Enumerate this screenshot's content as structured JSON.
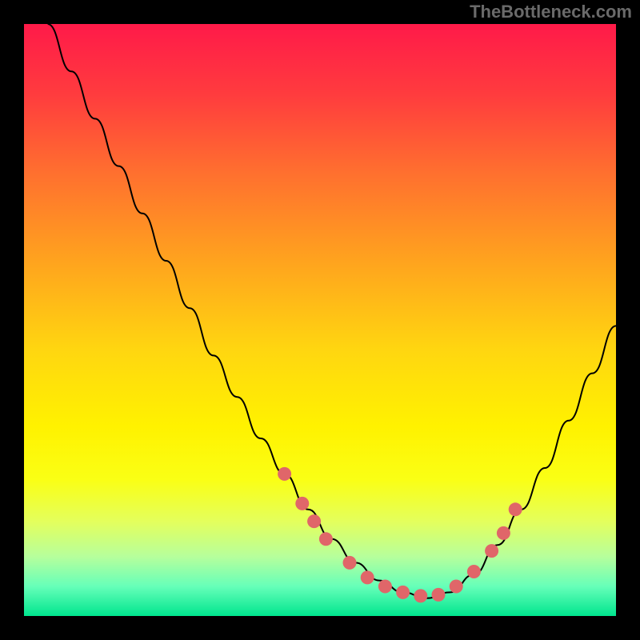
{
  "attribution": "TheBottleneck.com",
  "chart_data": {
    "type": "line",
    "title": "",
    "xlabel": "",
    "ylabel": "",
    "xlim": [
      0,
      100
    ],
    "ylim": [
      0,
      100
    ],
    "gradient_stops": [
      {
        "offset": 0,
        "color": "#ff1a49"
      },
      {
        "offset": 12,
        "color": "#ff3c3e"
      },
      {
        "offset": 25,
        "color": "#ff6f2f"
      },
      {
        "offset": 40,
        "color": "#ffa31e"
      },
      {
        "offset": 55,
        "color": "#ffd610"
      },
      {
        "offset": 68,
        "color": "#fff200"
      },
      {
        "offset": 77,
        "color": "#faff15"
      },
      {
        "offset": 84,
        "color": "#e4ff5c"
      },
      {
        "offset": 90,
        "color": "#b6ff9c"
      },
      {
        "offset": 95,
        "color": "#66ffb9"
      },
      {
        "offset": 100,
        "color": "#00e58e"
      }
    ],
    "series": [
      {
        "name": "bottleneck-curve",
        "x": [
          4,
          8,
          12,
          16,
          20,
          24,
          28,
          32,
          36,
          40,
          44,
          48,
          52,
          56,
          60,
          64,
          68,
          72,
          76,
          80,
          84,
          88,
          92,
          96,
          100
        ],
        "y": [
          100,
          92,
          84,
          76,
          68,
          60,
          52,
          44,
          37,
          30,
          24,
          18,
          13,
          9,
          6,
          4,
          3,
          4,
          7,
          12,
          18,
          25,
          33,
          41,
          49
        ]
      }
    ],
    "markers": {
      "name": "highlight-band",
      "x": [
        44,
        47,
        49,
        51,
        55,
        58,
        61,
        64,
        67,
        70,
        73,
        76,
        79,
        81,
        83
      ],
      "y": [
        24,
        19,
        16,
        13,
        9,
        6.5,
        5,
        4,
        3.4,
        3.6,
        5,
        7.5,
        11,
        14,
        18
      ]
    }
  }
}
